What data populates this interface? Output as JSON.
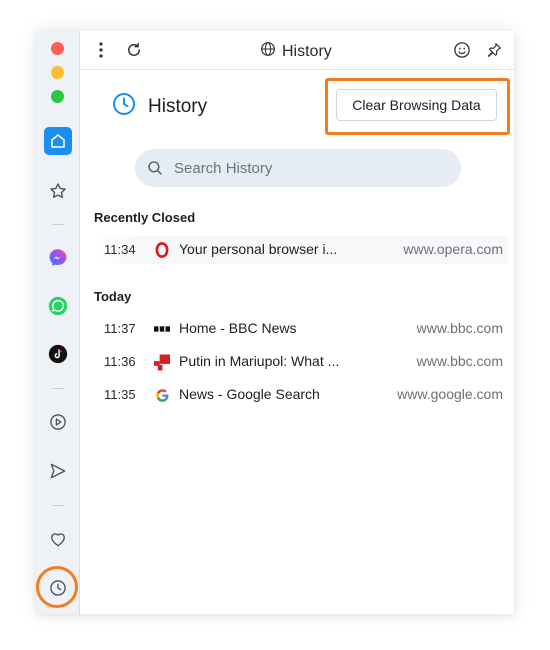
{
  "toolbar": {
    "title": "History"
  },
  "page": {
    "title": "History",
    "clear_button": "Clear Browsing Data"
  },
  "search": {
    "placeholder": "Search History"
  },
  "sections": [
    {
      "heading": "Recently Closed",
      "items": [
        {
          "time": "11:34",
          "title": "Your personal browser i...",
          "domain": "www.opera.com",
          "favicon": "opera-icon"
        }
      ]
    },
    {
      "heading": "Today",
      "items": [
        {
          "time": "11:37",
          "title": "Home - BBC News",
          "domain": "www.bbc.com",
          "favicon": "bbc-icon"
        },
        {
          "time": "11:36",
          "title": "Putin in Mariupol: What ...",
          "domain": "www.bbc.com",
          "favicon": "bbc-news-red-icon"
        },
        {
          "time": "11:35",
          "title": "News - Google Search",
          "domain": "www.google.com",
          "favicon": "google-icon"
        }
      ]
    }
  ],
  "sidebar": {
    "icons": [
      "home-icon",
      "star-icon",
      "messenger-icon",
      "whatsapp-icon",
      "tiktok-icon",
      "player-icon",
      "send-icon",
      "heart-icon",
      "clock-icon"
    ]
  },
  "colors": {
    "accent": "#1c8ef2",
    "highlight": "#f47c20"
  }
}
